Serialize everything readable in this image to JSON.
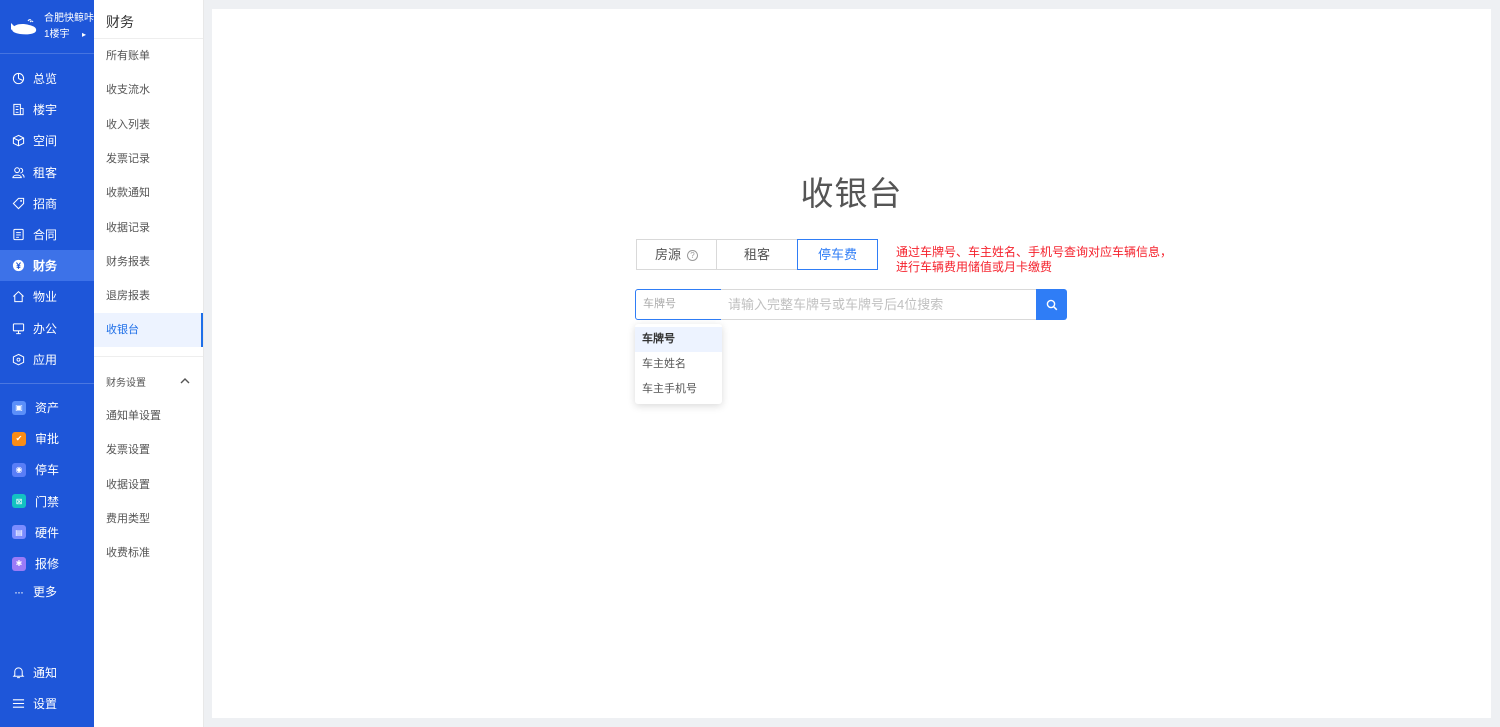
{
  "brand": {
    "name": "合肥快鲸咔",
    "building": "1楼宇",
    "caret": "▸"
  },
  "nav": [
    {
      "label": "总览",
      "icon": "dashboard-icon"
    },
    {
      "label": "楼宇",
      "icon": "building-icon"
    },
    {
      "label": "空间",
      "icon": "cube-icon"
    },
    {
      "label": "租客",
      "icon": "users-icon"
    },
    {
      "label": "招商",
      "icon": "tag-icon"
    },
    {
      "label": "合同",
      "icon": "document-icon"
    },
    {
      "label": "财务",
      "icon": "yuan-icon",
      "active": true
    },
    {
      "label": "物业",
      "icon": "home-icon"
    },
    {
      "label": "办公",
      "icon": "monitor-icon"
    },
    {
      "label": "应用",
      "icon": "app-icon"
    }
  ],
  "apps": [
    {
      "label": "资产",
      "color": "#5b8ff9",
      "icon": "asset-icon"
    },
    {
      "label": "审批",
      "color": "#fa8c16",
      "icon": "approval-icon"
    },
    {
      "label": "停车",
      "color": "#597ef7",
      "icon": "parking-icon"
    },
    {
      "label": "门禁",
      "color": "#13c2c2",
      "icon": "access-icon"
    },
    {
      "label": "硬件",
      "color": "#7b8cff",
      "icon": "hardware-icon"
    },
    {
      "label": "报修",
      "color": "#9b7bf7",
      "icon": "repair-icon"
    }
  ],
  "more_label": "更多",
  "bottom": {
    "notify": "通知",
    "settings": "设置"
  },
  "submenu": {
    "title": "财务",
    "items": [
      "所有账单",
      "收支流水",
      "收入列表",
      "发票记录",
      "收款通知",
      "收据记录",
      "财务报表",
      "退房报表",
      "收银台"
    ],
    "active_index": 8,
    "group_label": "财务设置",
    "group_items": [
      "通知单设置",
      "发票设置",
      "收据设置",
      "费用类型",
      "收费标准"
    ]
  },
  "main": {
    "title": "收银台",
    "tabs": [
      "房源",
      "租客",
      "停车费"
    ],
    "active_tab": 2,
    "hint_line1": "通过车牌号、车主姓名、手机号查询对应车辆信息，",
    "hint_line2": "进行车辆费用储值或月卡缴费",
    "select_value": "车牌号",
    "search_placeholder": "请输入完整车牌号或车牌号后4位搜索",
    "dropdown_options": [
      "车牌号",
      "车主姓名",
      "车主手机号"
    ],
    "dropdown_selected": 0
  },
  "colors": {
    "nav_bg": "#1e56d9",
    "accent": "#2f7df6",
    "hint": "#f5222d"
  }
}
